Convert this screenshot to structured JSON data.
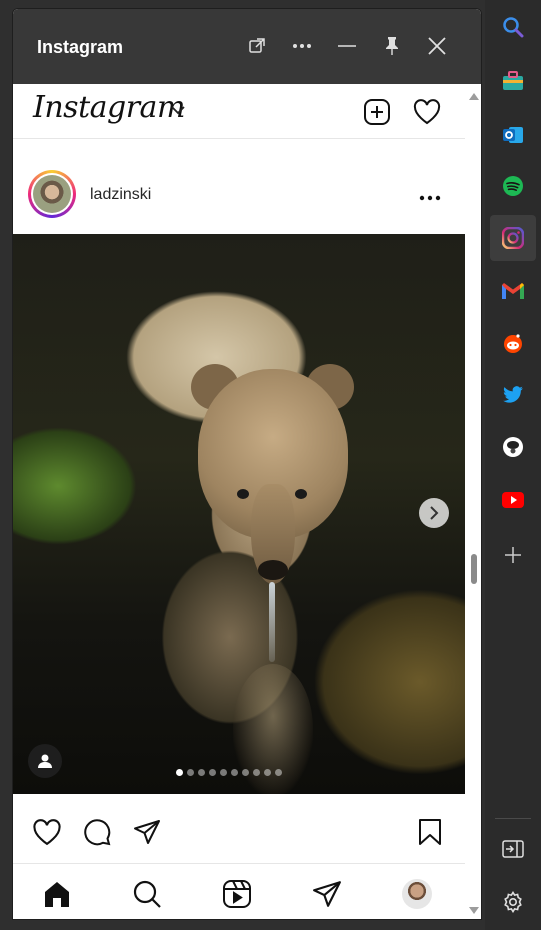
{
  "window": {
    "title": "Instagram",
    "buttons": [
      "open-external-icon",
      "more-icon",
      "minimize-icon",
      "pin-icon",
      "close-icon"
    ]
  },
  "app": {
    "logo_text": "Instagram"
  },
  "post": {
    "username": "ladzinski",
    "carousel": {
      "total_slides": 10,
      "active_index": 0
    }
  },
  "actions": [
    "heart-icon",
    "comment-icon",
    "share-icon",
    "save-icon"
  ],
  "bottom_nav": [
    "home-icon",
    "search-icon",
    "reels-icon",
    "direct-icon",
    "profile-avatar"
  ],
  "sidebar": {
    "items": [
      {
        "name": "search-icon",
        "color": "#3b8eea"
      },
      {
        "name": "shopping-icon",
        "color": "#2aa9a1"
      },
      {
        "name": "outlook-icon",
        "color": "#0f6cbd"
      },
      {
        "name": "spotify-icon",
        "color": "#1db954"
      },
      {
        "name": "instagram-icon",
        "color": "#e1306c",
        "active": true
      },
      {
        "name": "gmail-icon",
        "color": "#ea4335"
      },
      {
        "name": "reddit-icon",
        "color": "#ff4500"
      },
      {
        "name": "twitter-icon",
        "color": "#1da1f2"
      },
      {
        "name": "bubble-app-icon",
        "color": "#ffffff"
      },
      {
        "name": "youtube-icon",
        "color": "#ff0000"
      },
      {
        "name": "add-icon",
        "color": "#cccccc"
      }
    ],
    "bottom": [
      "sidebar-toggle-icon",
      "settings-icon"
    ]
  }
}
